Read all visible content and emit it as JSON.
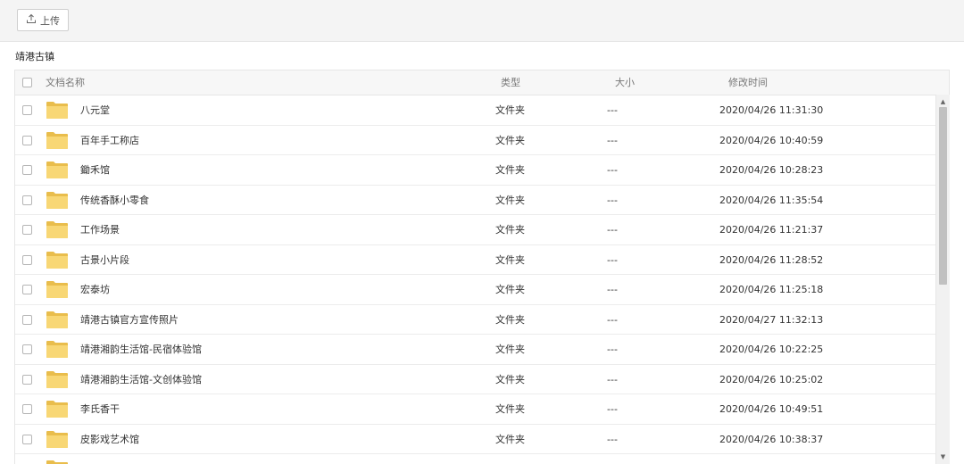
{
  "toolbar": {
    "upload_label": "上传"
  },
  "breadcrumb": "靖港古镇",
  "table": {
    "columns": {
      "name": "文档名称",
      "type": "类型",
      "size": "大小",
      "modified": "修改时间"
    },
    "rows": [
      {
        "name": "八元堂",
        "type": "文件夹",
        "size": "---",
        "modified": "2020/04/26 11:31:30"
      },
      {
        "name": "百年手工称店",
        "type": "文件夹",
        "size": "---",
        "modified": "2020/04/26 10:40:59"
      },
      {
        "name": "鋤禾馆",
        "type": "文件夹",
        "size": "---",
        "modified": "2020/04/26 10:28:23"
      },
      {
        "name": "传统香酥小零食",
        "type": "文件夹",
        "size": "---",
        "modified": "2020/04/26 11:35:54"
      },
      {
        "name": "工作场景",
        "type": "文件夹",
        "size": "---",
        "modified": "2020/04/26 11:21:37"
      },
      {
        "name": "古景小片段",
        "type": "文件夹",
        "size": "---",
        "modified": "2020/04/26 11:28:52"
      },
      {
        "name": "宏泰坊",
        "type": "文件夹",
        "size": "---",
        "modified": "2020/04/26 11:25:18"
      },
      {
        "name": "靖港古镇官方宣传照片",
        "type": "文件夹",
        "size": "---",
        "modified": "2020/04/27 11:32:13"
      },
      {
        "name": "靖港湘韵生活馆-民宿体验馆",
        "type": "文件夹",
        "size": "---",
        "modified": "2020/04/26 10:22:25"
      },
      {
        "name": "靖港湘韵生活馆-文创体验馆",
        "type": "文件夹",
        "size": "---",
        "modified": "2020/04/26 10:25:02"
      },
      {
        "name": "李氏香干",
        "type": "文件夹",
        "size": "---",
        "modified": "2020/04/26 10:49:51"
      },
      {
        "name": "皮影戏艺术馆",
        "type": "文件夹",
        "size": "---",
        "modified": "2020/04/26 10:38:37"
      },
      {
        "name": "",
        "type": "",
        "size": "",
        "modified": ""
      }
    ]
  },
  "icons": {
    "upload": "upload-icon",
    "folder": "folder-icon",
    "checkbox": "checkbox-icon"
  },
  "colors": {
    "folder": "#f8d775",
    "folder_dark": "#e9bd4c",
    "header_bg": "#f7f7f7"
  }
}
